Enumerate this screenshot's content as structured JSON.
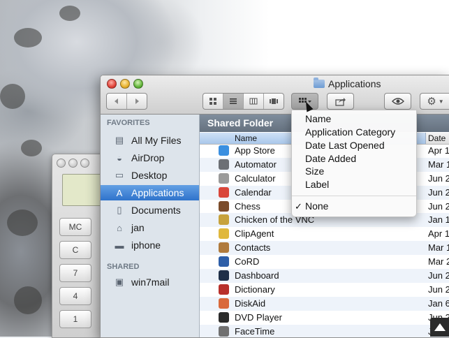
{
  "window": {
    "title": "Applications",
    "traffic_lights": [
      "close-button",
      "minimize-button",
      "zoom-button"
    ]
  },
  "toolbar": {
    "back_icon": "chevron-left-icon",
    "forward_icon": "chevron-right-icon",
    "view_modes": [
      "icon-view",
      "list-view",
      "column-view",
      "cover-flow-view"
    ],
    "active_view": "list-view",
    "arrange_icon": "arrange-grid-icon",
    "share_icon": "share-icon",
    "quicklook_icon": "eye-icon",
    "action_icon": "gear-icon"
  },
  "sidebar": {
    "favorites_heading": "FAVORITES",
    "favorites": [
      {
        "label": "All My Files",
        "icon": "all-files-icon"
      },
      {
        "label": "AirDrop",
        "icon": "airdrop-icon"
      },
      {
        "label": "Desktop",
        "icon": "desktop-icon"
      },
      {
        "label": "Applications",
        "icon": "applications-icon",
        "selected": true
      },
      {
        "label": "Documents",
        "icon": "documents-icon"
      },
      {
        "label": "jan",
        "icon": "home-icon"
      },
      {
        "label": "iphone",
        "icon": "folder-icon"
      }
    ],
    "shared_heading": "SHARED",
    "shared": [
      {
        "label": "win7mail",
        "icon": "computer-icon"
      }
    ]
  },
  "main": {
    "path_title": "Shared Folder",
    "columns": {
      "name": "Name",
      "date": "Date"
    },
    "rows": [
      {
        "name": "App Store",
        "date": "Apr 1",
        "color": "#3a8fe0"
      },
      {
        "name": "Automator",
        "date": "Mar 1",
        "color": "#6c6f75"
      },
      {
        "name": "Calculator",
        "date": "Jun 2",
        "color": "#9a9a9a"
      },
      {
        "name": "Calendar",
        "date": "Jun 2",
        "color": "#d9463a"
      },
      {
        "name": "Chess",
        "date": "Jun 2",
        "color": "#7b4b2a"
      },
      {
        "name": "Chicken of the VNC",
        "date": "Jan 1",
        "color": "#c7a23c"
      },
      {
        "name": "ClipAgent",
        "date": "Apr 1",
        "color": "#e0b83d"
      },
      {
        "name": "Contacts",
        "date": "Mar 1",
        "color": "#b07a3c"
      },
      {
        "name": "CoRD",
        "date": "Mar 2",
        "color": "#2d5ea8"
      },
      {
        "name": "Dashboard",
        "date": "Jun 2",
        "color": "#1f2f48"
      },
      {
        "name": "Dictionary",
        "date": "Jun 2",
        "color": "#b8302b"
      },
      {
        "name": "DiskAid",
        "date": "Jan 6",
        "color": "#d9693b"
      },
      {
        "name": "DVD Player",
        "date": "Jun 2",
        "color": "#2a2a2a"
      },
      {
        "name": "FaceTime",
        "date": "Jun 2",
        "color": "#707070"
      }
    ]
  },
  "arrange_menu": {
    "items": [
      "Name",
      "Application Category",
      "Date Last Opened",
      "Date Added",
      "Size",
      "Label"
    ],
    "checked_item": "None",
    "check_mark": "✓"
  },
  "calculator": {
    "keys": [
      "MC",
      "C",
      "7",
      "4",
      "1"
    ]
  }
}
